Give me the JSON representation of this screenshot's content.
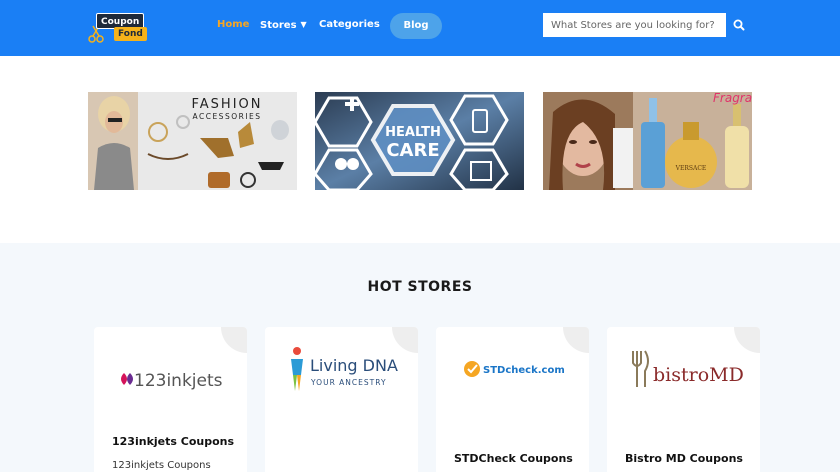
{
  "header": {
    "logo_line1": "Coupon",
    "logo_line2": "Fond",
    "nav": [
      {
        "label": "Home",
        "active": true
      },
      {
        "label": "Stores",
        "has_dropdown": true
      },
      {
        "label": "Categories"
      }
    ],
    "blog_label": "Blog",
    "search_placeholder": "What Stores are you looking for?",
    "search_icon": "search-icon",
    "colors": {
      "header_bg": "#1a7ff5",
      "active_nav": "#f5a623",
      "blog_bg": "#4da3ea"
    }
  },
  "banners": [
    {
      "name": "fashion-accessories",
      "title": "FASHION",
      "subtitle": "ACCESSORIES"
    },
    {
      "name": "health-care",
      "title": "HEALTH",
      "subtitle": "CARE"
    },
    {
      "name": "fragrance",
      "brand_text": "VERSACE"
    }
  ],
  "hot_stores": {
    "title": "HOT STORES",
    "cards": [
      {
        "logo": "123inkjets",
        "title": "123inkjets Coupons",
        "subtitle": "123inkjets Coupons"
      },
      {
        "logo_line1": "Living DNA",
        "logo_line2": "YOUR ANCESTRY",
        "title": "",
        "subtitle": ""
      },
      {
        "logo": "STDcheck.com",
        "title": "STDCheck Coupons",
        "subtitle": ""
      },
      {
        "logo": "bistroMD",
        "title": "Bistro MD Coupons",
        "subtitle": ""
      }
    ]
  }
}
